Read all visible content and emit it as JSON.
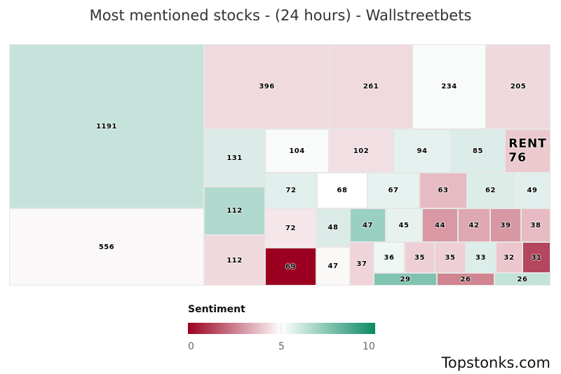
{
  "title": "Most mentioned stocks - (24 hours) - Wallstreetbets",
  "chart_data": {
    "type": "treemap",
    "title": "Most mentioned stocks - (24 hours) - Wallstreetbets",
    "value_label": "mentions",
    "color_scale": {
      "title": "Sentiment",
      "min": 0,
      "mid": 5,
      "max": 10,
      "colors": [
        "#9b0020",
        "#ffffff",
        "#0a8a64"
      ],
      "ticks": [
        "0",
        "5",
        "10"
      ]
    },
    "cells": [
      {
        "label": "1191",
        "value": 1191,
        "sentiment": 6.4,
        "color": "#c5e3db"
      },
      {
        "label": "556",
        "value": 556,
        "sentiment": 4.9,
        "color": "#fbf8f9"
      },
      {
        "label": "396",
        "value": 396,
        "sentiment": 4.1,
        "color": "#f0dadd"
      },
      {
        "label": "261",
        "value": 261,
        "sentiment": 4.1,
        "color": "#f0dadd"
      },
      {
        "label": "234",
        "value": 234,
        "sentiment": 5.1,
        "color": "#f9fbfb"
      },
      {
        "label": "205",
        "value": 205,
        "sentiment": 4.1,
        "color": "#efd9dc"
      },
      {
        "label": "131",
        "value": 131,
        "sentiment": 5.8,
        "color": "#dbece8"
      },
      {
        "label": "112",
        "value": 112,
        "sentiment": 6.8,
        "color": "#b1d9ce"
      },
      {
        "label": "112",
        "value": 112,
        "sentiment": 4.1,
        "color": "#f0d9dd"
      },
      {
        "label": "104",
        "value": 104,
        "sentiment": 5.1,
        "color": "#f9fbfb"
      },
      {
        "label": "102",
        "value": 102,
        "sentiment": 4.3,
        "color": "#f2dfe3"
      },
      {
        "label": "94",
        "value": 94,
        "sentiment": 5.6,
        "color": "#e4f1ee"
      },
      {
        "label": "85",
        "value": 85,
        "sentiment": 5.8,
        "color": "#dcede9"
      },
      {
        "label": "RENT\n76",
        "ticker": "RENT",
        "value": 76,
        "sentiment": 3.7,
        "color": "#ecc8cf"
      },
      {
        "label": "72",
        "value": 72,
        "sentiment": 5.7,
        "color": "#e1efec"
      },
      {
        "label": "68",
        "value": 68,
        "sentiment": 5.0,
        "color": "#ffffff"
      },
      {
        "label": "67",
        "value": 67,
        "sentiment": 5.5,
        "color": "#e6f2ef"
      },
      {
        "label": "63",
        "value": 63,
        "sentiment": 3.4,
        "color": "#e6bbc4"
      },
      {
        "label": "62",
        "value": 62,
        "sentiment": 5.8,
        "color": "#dcede8"
      },
      {
        "label": "49",
        "value": 49,
        "sentiment": 5.6,
        "color": "#e2f0ed"
      },
      {
        "label": "72",
        "value": 72,
        "sentiment": 4.5,
        "color": "#f5e6e9"
      },
      {
        "label": "69",
        "value": 69,
        "sentiment": 0.0,
        "color": "#9b0020"
      },
      {
        "label": "48",
        "value": 48,
        "sentiment": 5.8,
        "color": "#dbece8"
      },
      {
        "label": "47",
        "value": 47,
        "sentiment": 5.0,
        "color": "#fbf9f8"
      },
      {
        "label": "47",
        "value": 47,
        "sentiment": 7.2,
        "color": "#9ad0c1"
      },
      {
        "label": "45",
        "value": 45,
        "sentiment": 5.5,
        "color": "#e7f2ef"
      },
      {
        "label": "44",
        "value": 44,
        "sentiment": 2.7,
        "color": "#d898a4"
      },
      {
        "label": "42",
        "value": 42,
        "sentiment": 3.1,
        "color": "#dea8b2"
      },
      {
        "label": "39",
        "value": 39,
        "sentiment": 2.7,
        "color": "#d797a3"
      },
      {
        "label": "38",
        "value": 38,
        "sentiment": 3.5,
        "color": "#e7bbc4"
      },
      {
        "label": "37",
        "value": 37,
        "sentiment": 4.0,
        "color": "#f0d4da"
      },
      {
        "label": "36",
        "value": 36,
        "sentiment": 5.3,
        "color": "#eff7f5"
      },
      {
        "label": "35",
        "value": 35,
        "sentiment": 3.9,
        "color": "#edcfd5"
      },
      {
        "label": "35",
        "value": 35,
        "sentiment": 3.9,
        "color": "#edcfd5"
      },
      {
        "label": "33",
        "value": 33,
        "sentiment": 5.8,
        "color": "#dceee9"
      },
      {
        "label": "32",
        "value": 32,
        "sentiment": 3.7,
        "color": "#ecc7cd"
      },
      {
        "label": "31",
        "value": 31,
        "sentiment": 1.5,
        "color": "#b4465d"
      },
      {
        "label": "29",
        "value": 29,
        "sentiment": 7.6,
        "color": "#80c3b0"
      },
      {
        "label": "26",
        "value": 26,
        "sentiment": 2.3,
        "color": "#d0848f"
      },
      {
        "label": "26",
        "value": 26,
        "sentiment": 6.4,
        "color": "#c2e3da"
      }
    ]
  },
  "legend": {
    "title": "Sentiment",
    "ticks": [
      "0",
      "5",
      "10"
    ]
  },
  "footer": "Topstonks.com"
}
